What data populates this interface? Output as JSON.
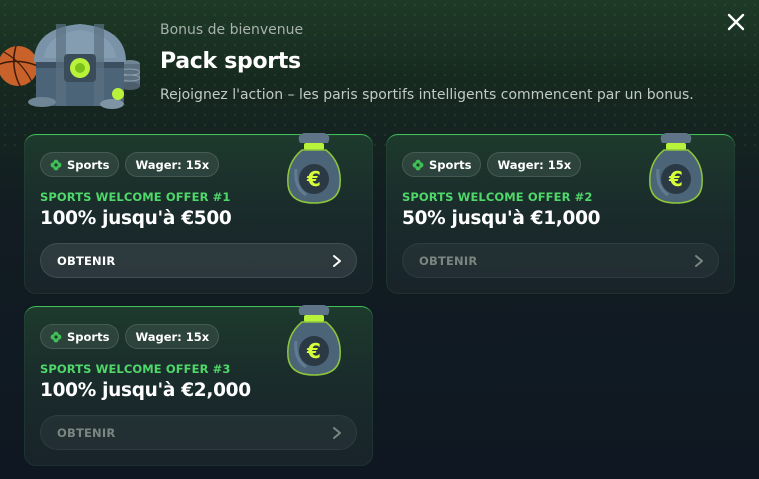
{
  "header": {
    "subtitle": "Bonus de bienvenue",
    "title": "Pack sports",
    "tagline": "Rejoignez l'action – les paris sportifs intelligents commencent par un bonus."
  },
  "close_icon": "close-icon",
  "offers": [
    {
      "tag_sport": "Sports",
      "tag_wager": "Wager: 15x",
      "label": "SPORTS WELCOME OFFER #1",
      "amount": "100% jusqu'à €500",
      "cta": "OBTENIR",
      "cta_enabled": true
    },
    {
      "tag_sport": "Sports",
      "tag_wager": "Wager: 15x",
      "label": "SPORTS WELCOME OFFER #2",
      "amount": "50% jusqu'à €1,000",
      "cta": "OBTENIR",
      "cta_enabled": false
    },
    {
      "tag_sport": "Sports",
      "tag_wager": "Wager: 15x",
      "label": "SPORTS WELCOME OFFER #3",
      "amount": "100% jusqu'à €2,000",
      "cta": "OBTENIR",
      "cta_enabled": false
    }
  ],
  "colors": {
    "accent_green": "#4fd86a",
    "card_border": "#3fbf55",
    "background": "#121c22"
  }
}
